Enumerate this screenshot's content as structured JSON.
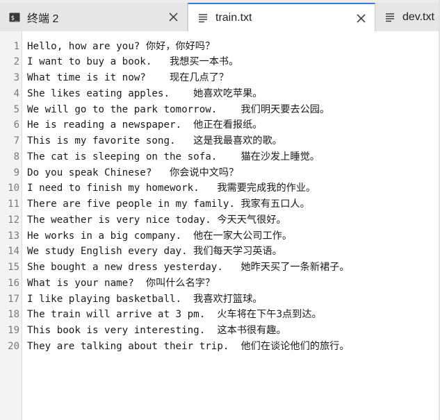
{
  "tabs": [
    {
      "label": "终端 2",
      "icon": "terminal-icon",
      "closable": true,
      "active": false
    },
    {
      "label": "train.txt",
      "icon": "document-icon",
      "closable": true,
      "active": true
    },
    {
      "label": "dev.txt",
      "icon": "document-icon",
      "closable": false,
      "active": false
    }
  ],
  "editor": {
    "lines": [
      {
        "number": "1",
        "text": "Hello, how are you? 你好，你好吗？"
      },
      {
        "number": "2",
        "text": "I want to buy a book.   我想买一本书。"
      },
      {
        "number": "3",
        "text": "What time is it now?    现在几点了？"
      },
      {
        "number": "4",
        "text": "She likes eating apples.    她喜欢吃苹果。"
      },
      {
        "number": "5",
        "text": "We will go to the park tomorrow.    我们明天要去公园。"
      },
      {
        "number": "6",
        "text": "He is reading a newspaper.  他正在看报纸。"
      },
      {
        "number": "7",
        "text": "This is my favorite song.   这是我最喜欢的歌。"
      },
      {
        "number": "8",
        "text": "The cat is sleeping on the sofa.    猫在沙发上睡觉。"
      },
      {
        "number": "9",
        "text": "Do you speak Chinese?   你会说中文吗？"
      },
      {
        "number": "10",
        "text": "I need to finish my homework.   我需要完成我的作业。"
      },
      {
        "number": "11",
        "text": "There are five people in my family. 我家有五口人。"
      },
      {
        "number": "12",
        "text": "The weather is very nice today. 今天天气很好。"
      },
      {
        "number": "13",
        "text": "He works in a big company.  他在一家大公司工作。"
      },
      {
        "number": "14",
        "text": "We study English every day. 我们每天学习英语。"
      },
      {
        "number": "15",
        "text": "She bought a new dress yesterday.   她昨天买了一条新裙子。"
      },
      {
        "number": "16",
        "text": "What is your name?  你叫什么名字？"
      },
      {
        "number": "17",
        "text": "I like playing basketball.  我喜欢打篮球。"
      },
      {
        "number": "18",
        "text": "The train will arrive at 3 pm.  火车将在下午3点到达。"
      },
      {
        "number": "19",
        "text": "This book is very interesting.  这本书很有趣。"
      },
      {
        "number": "20",
        "text": "They are talking about their trip.  他们在谈论他们的旅行。"
      }
    ]
  },
  "colors": {
    "active_tab_accent": "#3b7cd8",
    "gutter_background": "#f3f3f3",
    "line_number": "#7a7a7a",
    "text": "#1a1a1a"
  }
}
